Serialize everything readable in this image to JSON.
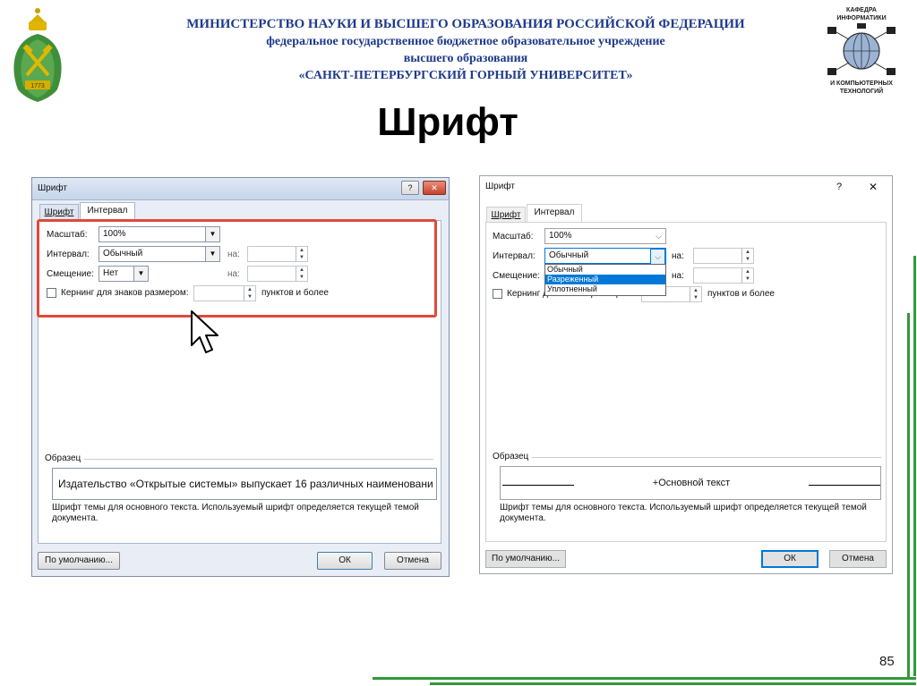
{
  "header": {
    "line1": "МИНИСТЕРСТВО НАУКИ И ВЫСШЕГО ОБРАЗОВАНИЯ РОССИЙСКОЙ ФЕДЕРАЦИИ",
    "line2": "федеральное государственное бюджетное образовательное учреждение",
    "line3": "высшего образования",
    "line4": "«САНКТ-ПЕТЕРБУРГСКИЙ ГОРНЫЙ УНИВЕРСИТЕТ»"
  },
  "slide_title": "Шрифт",
  "logo_right": {
    "top1": "КАФЕДРА",
    "top2": "ИНФОРМАТИКИ",
    "bottom1": "И КОМПЬЮТЕРНЫХ",
    "bottom2": "ТЕХНОЛОГИЙ"
  },
  "logo_left": {
    "year": "1773"
  },
  "page_number": "85",
  "colors": {
    "title_blue": "#1f3a8a",
    "accent_green": "#2f9a3a",
    "highlight_red": "#e0493a"
  },
  "dialog_left": {
    "title": "Шрифт",
    "help_btn": "?",
    "close_btn": "✕",
    "tab_font": "Шрифт",
    "tab_interval": "Интервал",
    "scale_label": "Масштаб:",
    "scale_value": "100%",
    "interval_label": "Интервал:",
    "interval_value": "Обычный",
    "on_label1": "на:",
    "offset_label": "Смещение:",
    "offset_value": "Нет",
    "on_label2": "на:",
    "kerning_label": "Кернинг для знаков размером:",
    "kerning_suffix": "пунктов и более",
    "sample_label": "Образец",
    "sample_text": "Издательство «Открытые системы» выпускает 16 различных наименовани",
    "sample_note": "Шрифт темы для основного текста. Используемый шрифт определяется текущей темой документа.",
    "default_btn": "По умолчанию...",
    "ok_btn": "ОК",
    "cancel_btn": "Отмена"
  },
  "dialog_right": {
    "title": "Шрифт",
    "help_btn": "?",
    "close_btn": "✕",
    "tab_font": "Шрифт",
    "tab_interval": "Интервал",
    "scale_label": "Масштаб:",
    "scale_value": "100%",
    "interval_label": "Интервал:",
    "interval_value": "Обычный",
    "dropdown_options": [
      "Обычный",
      "Разреженный",
      "Уплотненный"
    ],
    "on_label1": "на:",
    "offset_label": "Смещение:",
    "on_label2": "на:",
    "kerning_label": "Кернинг для знаков размером:",
    "kerning_suffix": "пунктов и более",
    "sample_label": "Образец",
    "sample_text": "+Основной текст",
    "sample_note": "Шрифт темы для основного текста. Используемый шрифт определяется текущей темой документа.",
    "default_btn": "По умолчанию...",
    "ok_btn": "ОК",
    "cancel_btn": "Отмена"
  }
}
